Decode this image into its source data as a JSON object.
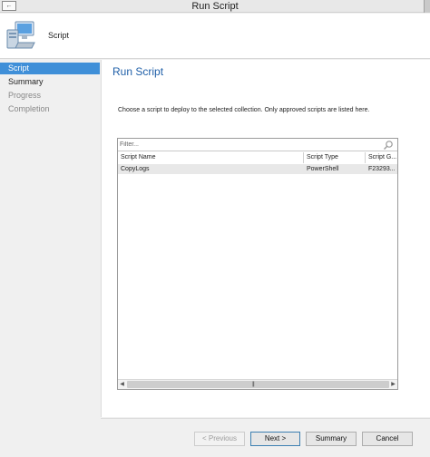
{
  "window": {
    "title": "Run Script"
  },
  "header": {
    "title": "Script",
    "icon": "computer-icon"
  },
  "sidebar": {
    "items": [
      {
        "label": "Script",
        "state": "active"
      },
      {
        "label": "Summary",
        "state": "done"
      },
      {
        "label": "Progress",
        "state": "pending"
      },
      {
        "label": "Completion",
        "state": "pending"
      }
    ]
  },
  "main": {
    "heading": "Run Script",
    "instructions": "Choose a script to deploy to the selected collection. Only approved scripts are listed here.",
    "filter": {
      "placeholder": "Filter..."
    },
    "table": {
      "columns": [
        "Script Name",
        "Script Type",
        "Script G..."
      ],
      "rows": [
        [
          "CopyLogs",
          "PowerShell",
          "F23293..."
        ]
      ]
    }
  },
  "footer": {
    "previous": "< Previous",
    "next": "Next >",
    "summary": "Summary",
    "cancel": "Cancel"
  },
  "colors": {
    "accent": "#3f8fd8",
    "heading": "#1f5fa8"
  }
}
